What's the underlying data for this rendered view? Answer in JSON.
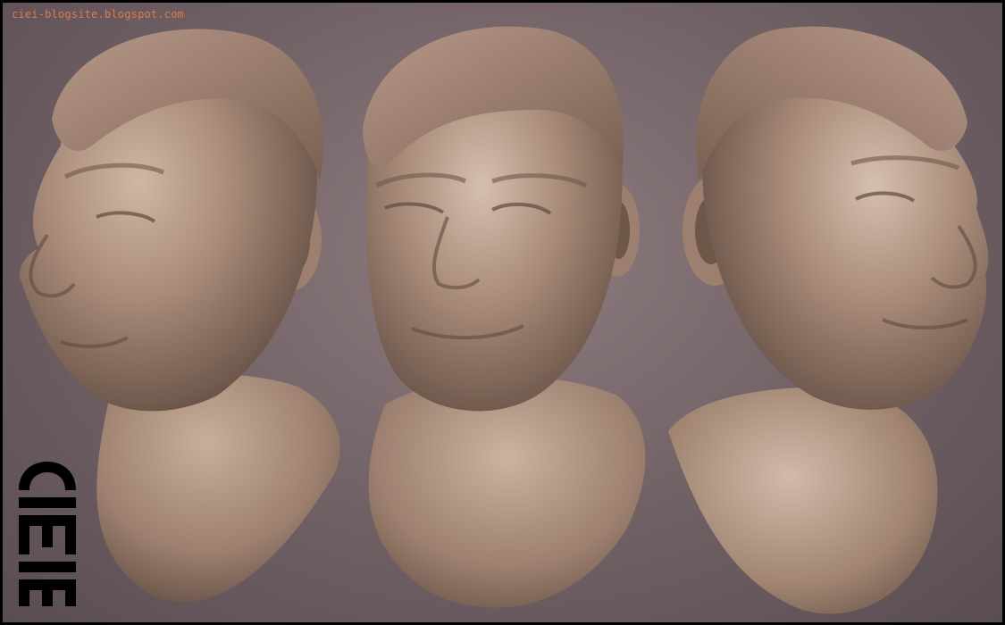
{
  "watermark": "ciei-blogsite.blogspot.com",
  "logo": {
    "text": "CIEI",
    "icon": "ciei-logo-icon"
  },
  "busts": [
    {
      "name": "bust-left-three-quarter",
      "icon": "sculpt-head-left-icon"
    },
    {
      "name": "bust-front-three-quarter",
      "icon": "sculpt-head-front-icon"
    },
    {
      "name": "bust-right-three-quarter",
      "icon": "sculpt-head-right-icon"
    }
  ],
  "colors": {
    "background": "#6f6064",
    "clay": "#a88a78",
    "clay_shadow": "#5e4a40",
    "clay_highlight": "#d6bfae",
    "watermark": "#e07a4a",
    "logo": "#000000"
  }
}
